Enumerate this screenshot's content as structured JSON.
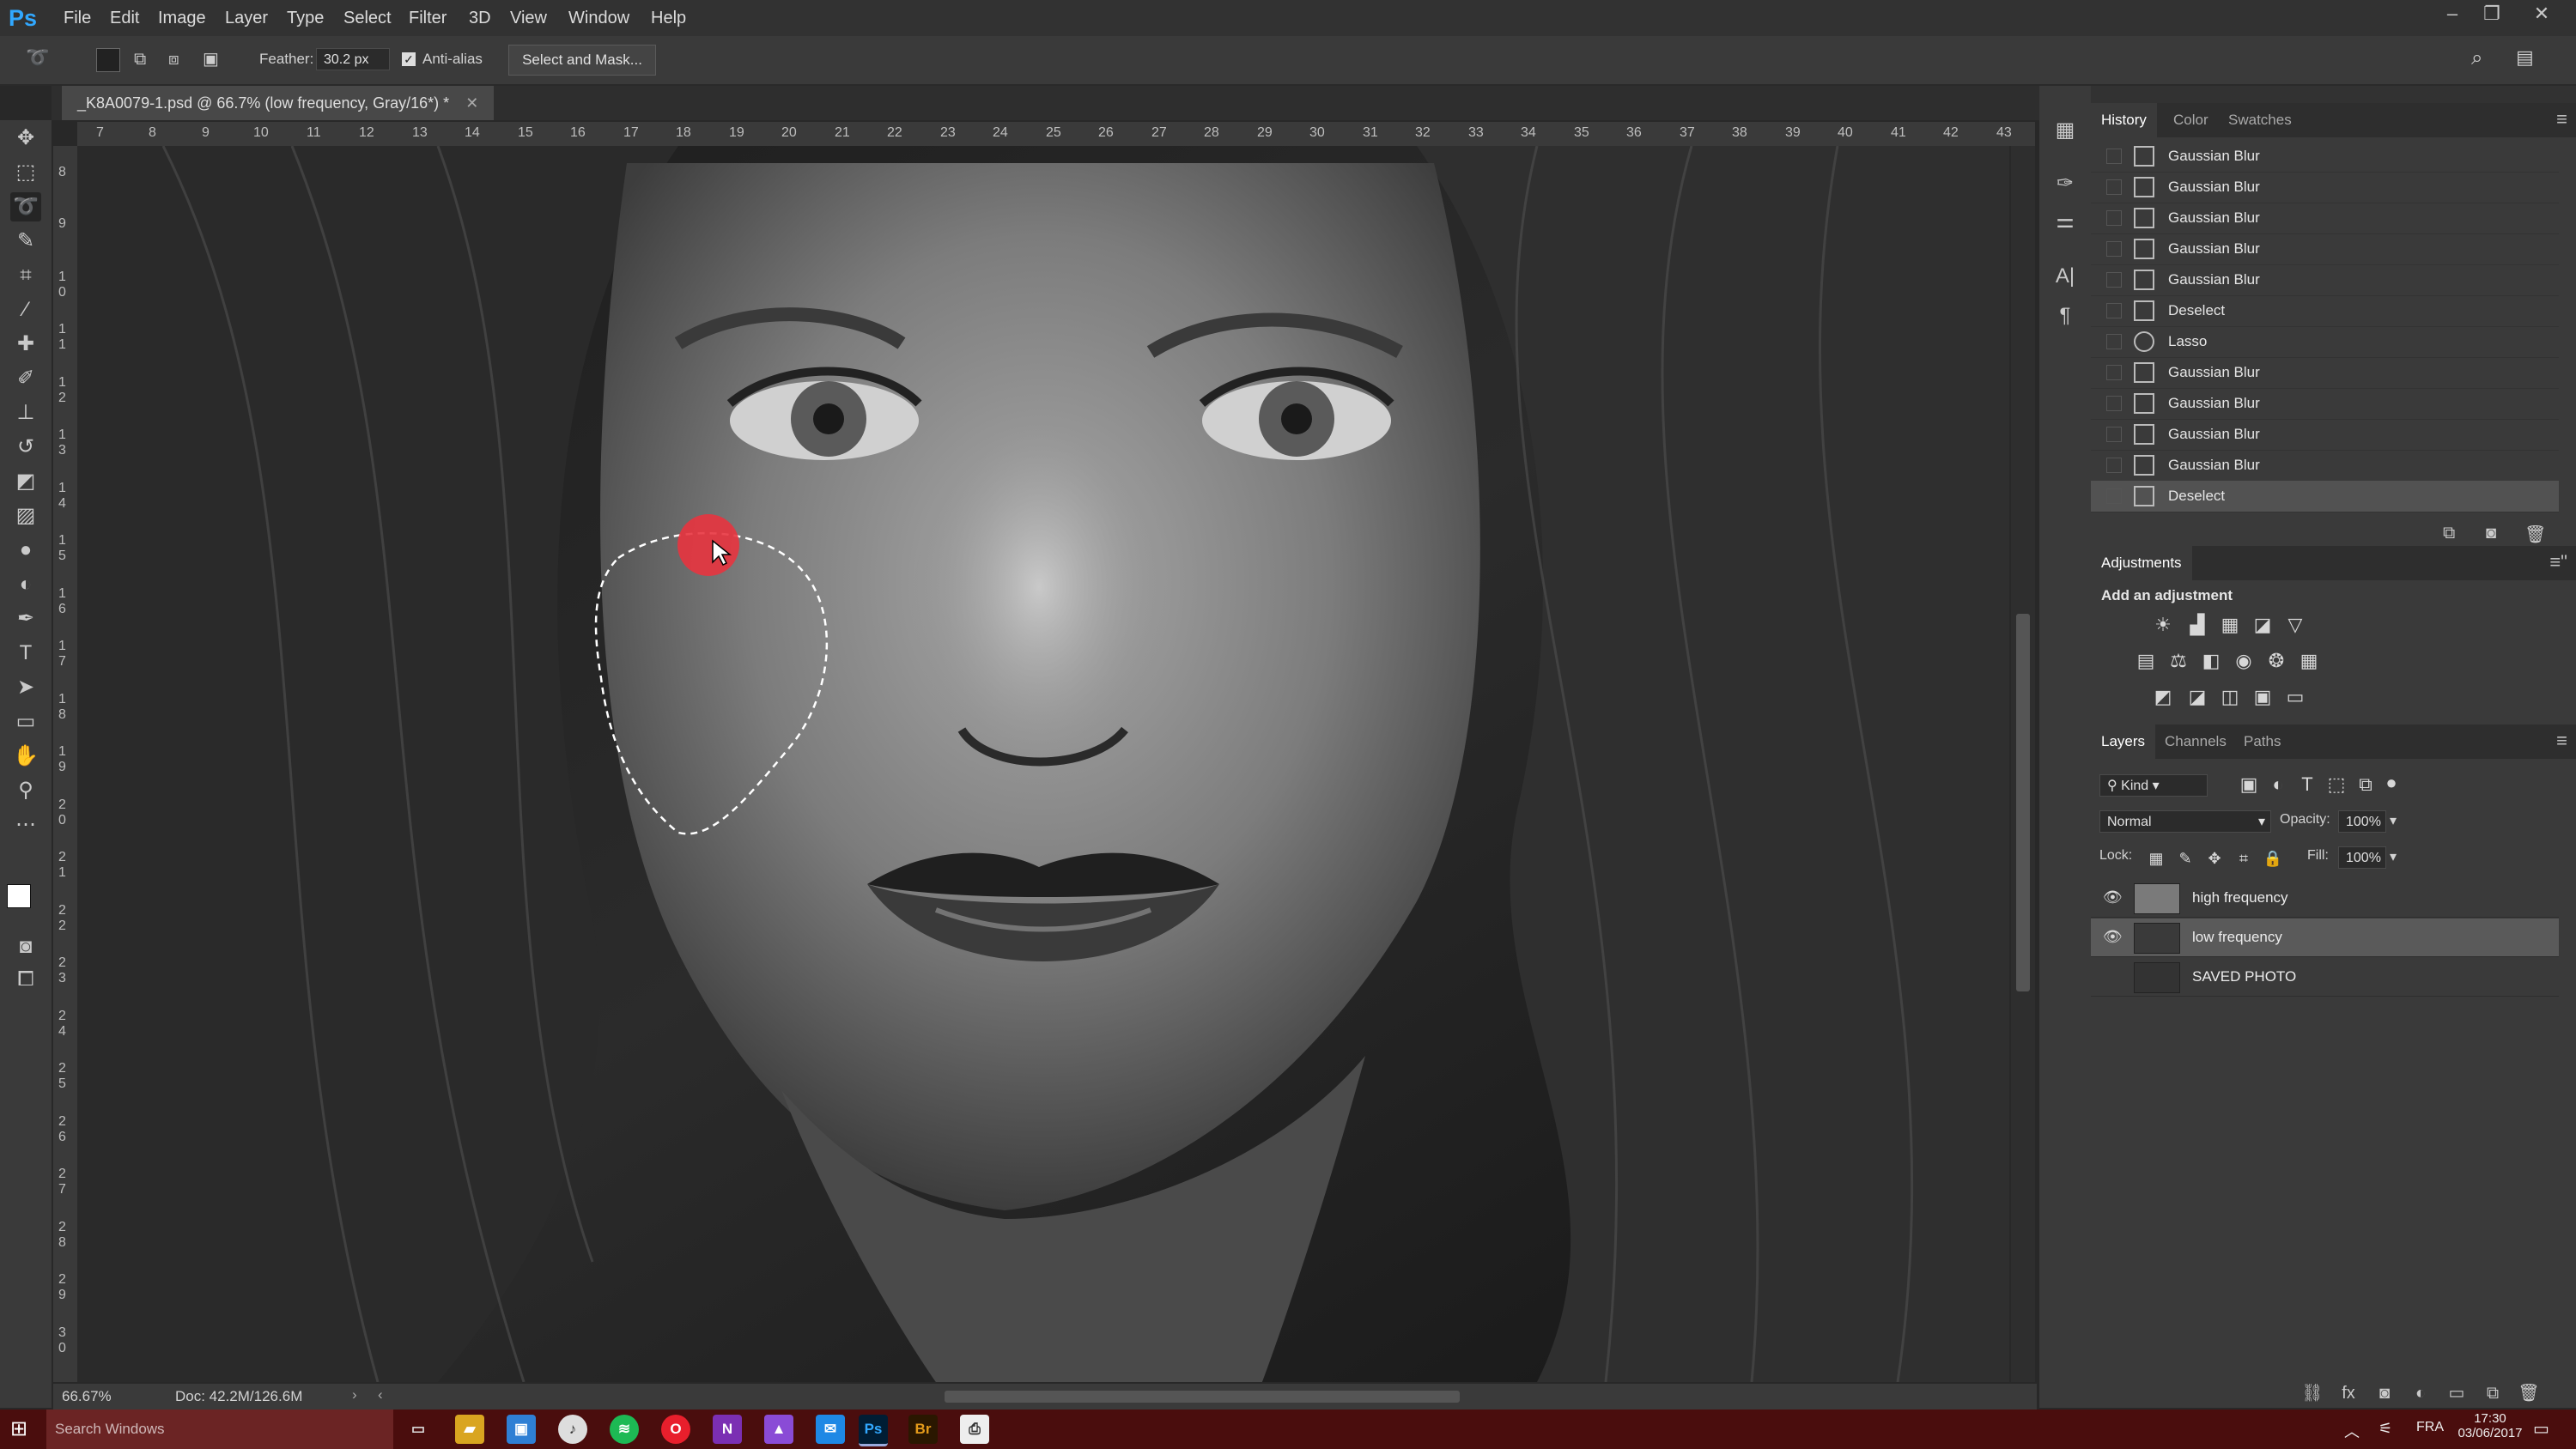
{
  "app": {
    "logo": "Ps"
  },
  "menu": [
    "File",
    "Edit",
    "Image",
    "Layer",
    "Type",
    "Select",
    "Filter",
    "3D",
    "View",
    "Window",
    "Help"
  ],
  "options": {
    "feather_label": "Feather:",
    "feather_value": "30.2 px",
    "antialias_label": "Anti-alias",
    "select_mask_label": "Select and Mask..."
  },
  "document": {
    "tab_title": "_K8A0079-1.psd @ 66.7% (low frequency, Gray/16*) *",
    "zoom": "66.67%",
    "doc_size": "Doc: 42.2M/126.6M"
  },
  "rulers": {
    "h": [
      "7",
      "8",
      "9",
      "10",
      "11",
      "12",
      "13",
      "14",
      "15",
      "16",
      "17",
      "18",
      "19",
      "20",
      "21",
      "22",
      "23",
      "24",
      "25",
      "26",
      "27",
      "28",
      "29",
      "30",
      "31",
      "32",
      "33",
      "34",
      "35",
      "36",
      "37",
      "38",
      "39",
      "40",
      "41",
      "42",
      "43"
    ],
    "v": [
      "8",
      "9",
      "1 0",
      "1 1",
      "1 2",
      "1 3",
      "1 4",
      "1 5",
      "1 6",
      "1 7",
      "1 8",
      "1 9",
      "2 0",
      "2 1",
      "2 2",
      "2 3",
      "2 4",
      "2 5",
      "2 6",
      "2 7",
      "2 8",
      "2 9",
      "3 0"
    ]
  },
  "history": {
    "tabs": [
      "History",
      "Color",
      "Swatches"
    ],
    "items": [
      "Gaussian Blur",
      "Gaussian Blur",
      "Gaussian Blur",
      "Gaussian Blur",
      "Gaussian Blur",
      "Deselect",
      "Lasso",
      "Gaussian Blur",
      "Gaussian Blur",
      "Gaussian Blur",
      "Gaussian Blur",
      "Deselect"
    ]
  },
  "adjustments": {
    "title": "Adjustments",
    "subtitle": "Add an adjustment"
  },
  "layers": {
    "tabs": [
      "Layers",
      "Channels",
      "Paths"
    ],
    "kind": "Kind",
    "blend_mode": "Normal",
    "opacity_label": "Opacity:",
    "opacity_value": "100%",
    "lock_label": "Lock:",
    "fill_label": "Fill:",
    "fill_value": "100%",
    "items": [
      "high frequency",
      "low frequency",
      "SAVED PHOTO"
    ]
  },
  "taskbar": {
    "search_placeholder": "Search Windows",
    "time": "17:30",
    "date": "03/06/2017",
    "lang": "FRA"
  },
  "colors": {
    "taskbar": "#4a0d0d",
    "accent": "#31a8ff",
    "cursor": "#e8343f"
  }
}
